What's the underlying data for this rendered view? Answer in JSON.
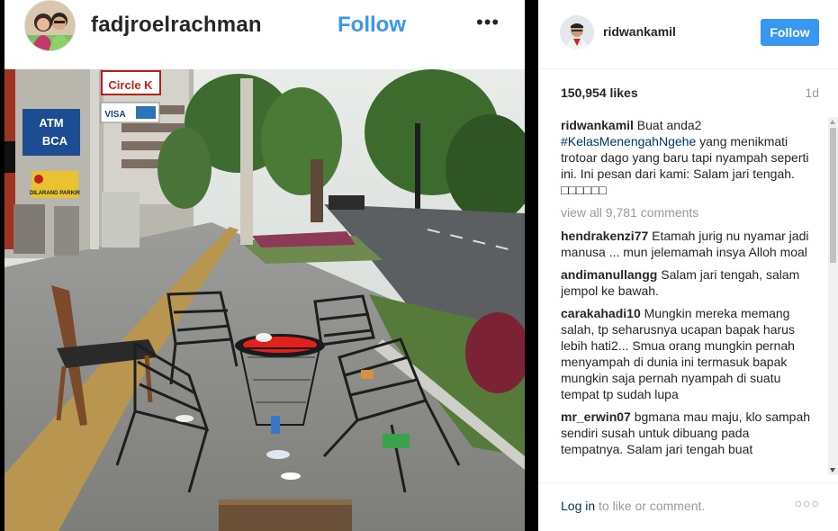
{
  "left_post": {
    "username": "fadjroelrachman",
    "follow_label": "Follow",
    "more_label": "•••",
    "photo_signs": {
      "circle_k": "Circle K",
      "atm": "ATM",
      "bank": "BCA",
      "visa": "VISA",
      "parking": "DILARANG PARKIR"
    }
  },
  "right_post": {
    "username": "ridwankamil",
    "follow_label": "Follow",
    "likes": "150,954 likes",
    "time": "1d",
    "caption": {
      "user": "ridwankamil",
      "text_before": " Buat anda2 ",
      "hashtag": "#KelasMenengahNgehe",
      "text_after": " yang menikmati trotoar dago yang baru tapi nyampah seperti ini. Ini pesan dari kami: Salam jari tengah. □□□□□□"
    },
    "view_all": "view all 9,781 comments",
    "comments": [
      {
        "user": "hendrakenzi77",
        "text": " Etamah jurig nu nyamar jadi manusa ... mun jelemamah insya Alloh moal"
      },
      {
        "user": "andimanullangg",
        "text": " Salam jari tengah, salam jempol ke bawah."
      },
      {
        "user": "carakahadi10",
        "text": " Mungkin mereka memang salah, tp seharusnya ucapan bapak harus lebih hati2... Smua orang mungkin pernah menyampah di dunia ini termasuk bapak mungkin saja pernah nyampah di suatu tempat tp sudah lupa"
      },
      {
        "user": "mr_erwin07",
        "text": " bgmana mau maju, klo sampah sendiri susah untuk dibuang pada tempatnya. Salam jari tengah buat"
      }
    ],
    "footer": {
      "login_link": "Log in",
      "login_text": " to like or comment.",
      "more": "○○○"
    }
  },
  "colors": {
    "accent": "#3897f0",
    "hashtag": "#003569",
    "muted": "#999999",
    "text": "#262626"
  }
}
